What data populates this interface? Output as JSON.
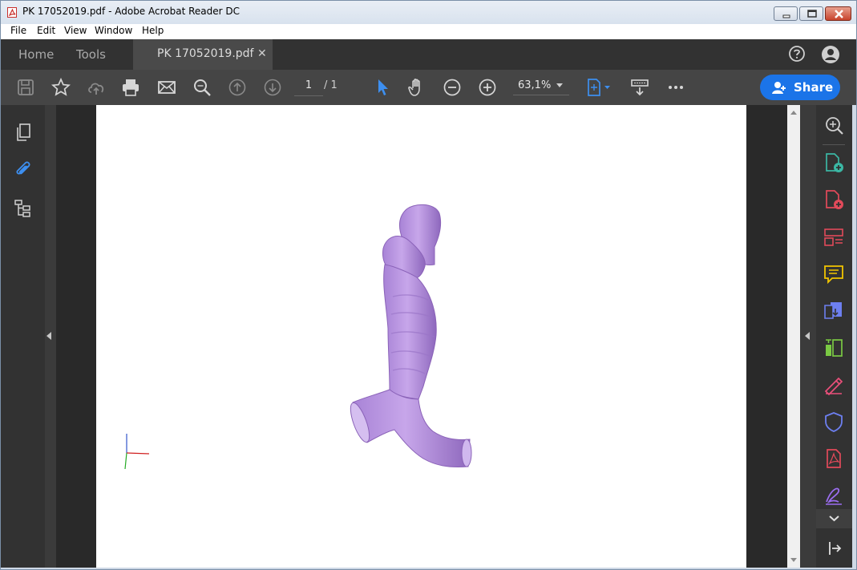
{
  "window": {
    "title": "PK 17052019.pdf - Adobe Acrobat Reader DC",
    "app_icon": "acrobat-pdf-icon"
  },
  "menu": {
    "items": [
      "File",
      "Edit",
      "View",
      "Window",
      "Help"
    ]
  },
  "tabs": {
    "home": "Home",
    "tools": "Tools",
    "document": "PK 17052019.pdf",
    "close_glyph": "✕"
  },
  "toolbar": {
    "icons": [
      "save-icon",
      "bookmark-star-icon",
      "upload-cloud-icon",
      "print-icon",
      "email-icon",
      "search-zoom-icon",
      "page-up-icon",
      "page-down-icon",
      "select-arrow-icon",
      "hand-tool-icon",
      "zoom-out-icon",
      "zoom-in-icon",
      "fit-page-icon",
      "read-mode-icon",
      "more-icon"
    ],
    "page_current": "1",
    "page_total": "/ 1",
    "zoom": "63,1%",
    "share_label": "Share"
  },
  "left_rail": {
    "icons": [
      "pages-icon",
      "attachments-icon",
      "bookmarks-tree-icon"
    ]
  },
  "right_rail": {
    "icons": [
      "zoom-search-icon",
      "create-pdf-icon",
      "combine-files-icon",
      "organize-pages-icon",
      "comment-icon",
      "export-pdf-icon",
      "edit-pdf-icon",
      "fill-sign-icon",
      "protect-icon",
      "pdf-file-icon",
      "sign-pen-icon",
      "chevron-down-icon",
      "expand-panel-icon"
    ]
  },
  "colors": {
    "accent": "#1b74e8",
    "model": "#c4a2e8",
    "toolbar": "#454545",
    "rail": "#323232"
  }
}
